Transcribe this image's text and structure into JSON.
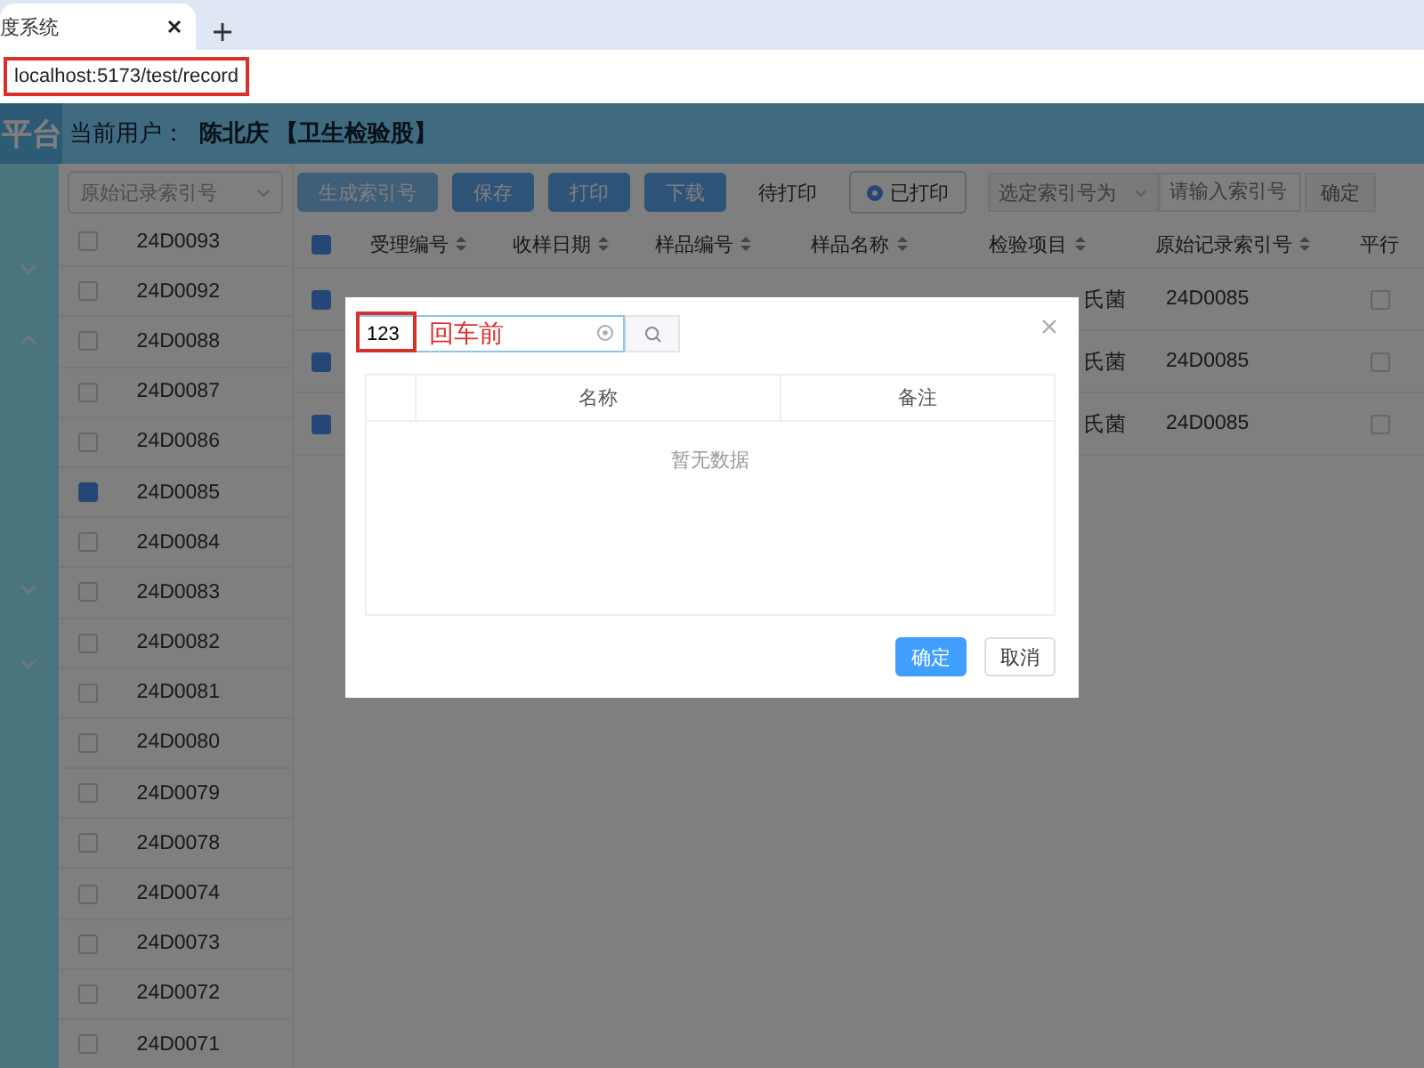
{
  "browser": {
    "tabs": [
      {
        "title": "度系统",
        "selected": true
      }
    ],
    "url": "localhost:5173/test/record"
  },
  "header": {
    "logo": "平台",
    "user_label": "当前用户：",
    "user": "陈北庆 【卫生检验股】"
  },
  "sidebar": {
    "items": [
      {
        "expanded": false
      },
      {
        "expanded": true
      },
      {
        "expanded": false
      },
      {
        "expanded": false
      }
    ]
  },
  "index_panel": {
    "select": "原始记录索引号",
    "items": [
      {
        "label": "24D0093",
        "checked": false
      },
      {
        "label": "24D0092",
        "checked": false
      },
      {
        "label": "24D0088",
        "checked": false
      },
      {
        "label": "24D0087",
        "checked": false
      },
      {
        "label": "24D0086",
        "checked": false
      },
      {
        "label": "24D0085",
        "checked": true
      },
      {
        "label": "24D0084",
        "checked": false
      },
      {
        "label": "24D0083",
        "checked": false
      },
      {
        "label": "24D0082",
        "checked": false
      },
      {
        "label": "24D0081",
        "checked": false
      },
      {
        "label": "24D0080",
        "checked": false
      },
      {
        "label": "24D0079",
        "checked": false
      },
      {
        "label": "24D0078",
        "checked": false
      },
      {
        "label": "24D0074",
        "checked": false
      },
      {
        "label": "24D0073",
        "checked": false
      },
      {
        "label": "24D0072",
        "checked": false
      },
      {
        "label": "24D0071",
        "checked": false
      }
    ]
  },
  "toolbar": {
    "buttons": [
      {
        "label": "生成索引号",
        "kind": "primary",
        "disabled": true
      },
      {
        "label": "保存",
        "kind": "primary",
        "disabled": false
      },
      {
        "label": "打印",
        "kind": "primary",
        "disabled": false
      },
      {
        "label": "下载",
        "kind": "primary",
        "disabled": false
      }
    ],
    "print_filter": [
      {
        "label": "待打印",
        "selected": false
      },
      {
        "label": "已打印",
        "selected": true
      }
    ],
    "index_select": {
      "placeholder": "选定索引号为",
      "disabled": true
    },
    "index_input": {
      "placeholder": "请输入索引号"
    },
    "confirm": {
      "label": "确定",
      "disabled": true
    }
  },
  "table": {
    "all_checked": true,
    "columns": [
      "受理编号",
      "收样日期",
      "样品编号",
      "样品名称",
      "检验项目",
      "原始记录索引号",
      "平行"
    ],
    "rows": [
      {
        "checked": true,
        "item": "氏菌",
        "index": "24D0085",
        "parallel": false
      },
      {
        "checked": true,
        "item": "氏菌",
        "index": "24D0085",
        "parallel": false
      },
      {
        "checked": true,
        "item": "氏菌",
        "index": "24D0085",
        "parallel": false
      }
    ]
  },
  "dialog": {
    "search": {
      "value": "123"
    },
    "annotation": "回车前",
    "columns": [
      "名称",
      "备注"
    ],
    "empty_text": "暂无数据",
    "buttons": [
      {
        "label": "确定",
        "kind": "primary"
      },
      {
        "label": "取消",
        "kind": "default"
      }
    ]
  }
}
